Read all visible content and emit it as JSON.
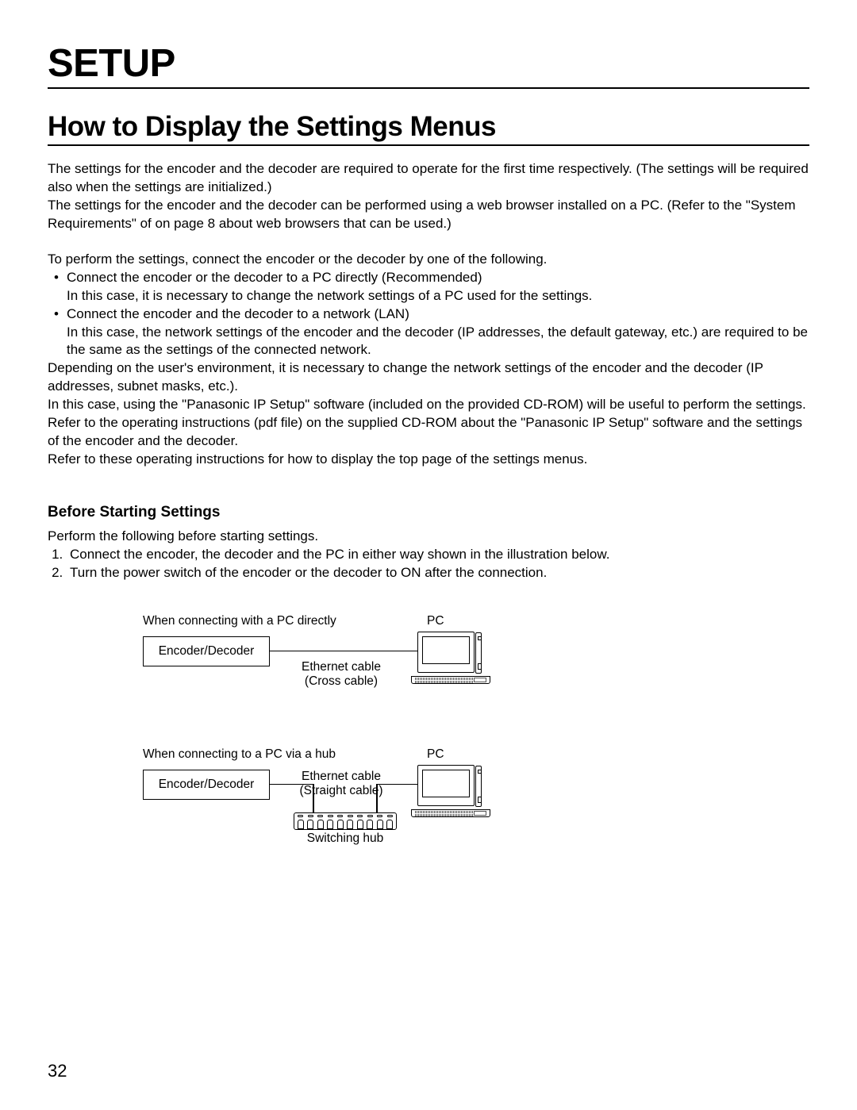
{
  "setup_title": "SETUP",
  "section_title": "How to Display the Settings Menus",
  "intro": {
    "p1": "The settings for the encoder and the decoder are required to operate for the first time respectively. (The settings will be required also when the settings are initialized.)",
    "p2": "The settings for the encoder and the decoder can be performed using a web browser installed on a PC. (Refer to the \"System Requirements\" of on page 8 about web browsers that can be used.)"
  },
  "connect": {
    "lead": "To perform the settings, connect the encoder or the decoder by one of the following.",
    "bullets": [
      {
        "line1": "Connect the encoder or the decoder to a PC directly (Recommended)",
        "line2": "In this case, it is necessary to change the network settings of a PC used for the settings."
      },
      {
        "line1": "Connect the encoder and the decoder to a network (LAN)",
        "line2": "In this case, the network settings of the encoder and the decoder (IP addresses, the default gateway, etc.) are required to be the same as the settings of the connected network."
      }
    ],
    "p3": "Depending on the user's environment, it is necessary to change the network settings of the encoder and the decoder (IP addresses, subnet masks, etc.).",
    "p4": "In this case, using the \"Panasonic IP Setup\" software (included on the provided CD-ROM) will be useful to perform the settings.",
    "p5": "Refer to the operating instructions (pdf file) on the supplied CD-ROM about the \"Panasonic IP Setup\" software and the settings of the encoder and the decoder.",
    "p6": "Refer to these operating instructions for how to display the top page of the settings menus."
  },
  "before": {
    "heading": "Before Starting Settings",
    "lead": "Perform the following before starting settings.",
    "steps": [
      "Connect the encoder, the decoder and the PC in either way shown in the illustration below.",
      "Turn the power switch of the encoder or the decoder to ON after the connection."
    ]
  },
  "diagram": {
    "d1": {
      "title": "When connecting with a PC directly",
      "box": "Encoder/Decoder",
      "cable1": "Ethernet cable",
      "cable2": "(Cross cable)",
      "pc": "PC"
    },
    "d2": {
      "title": "When connecting to a PC via a hub",
      "box": "Encoder/Decoder",
      "cable1": "Ethernet cable",
      "cable2": "(Straight cable)",
      "hub": "Switching hub",
      "pc": "PC"
    }
  },
  "page_number": "32"
}
